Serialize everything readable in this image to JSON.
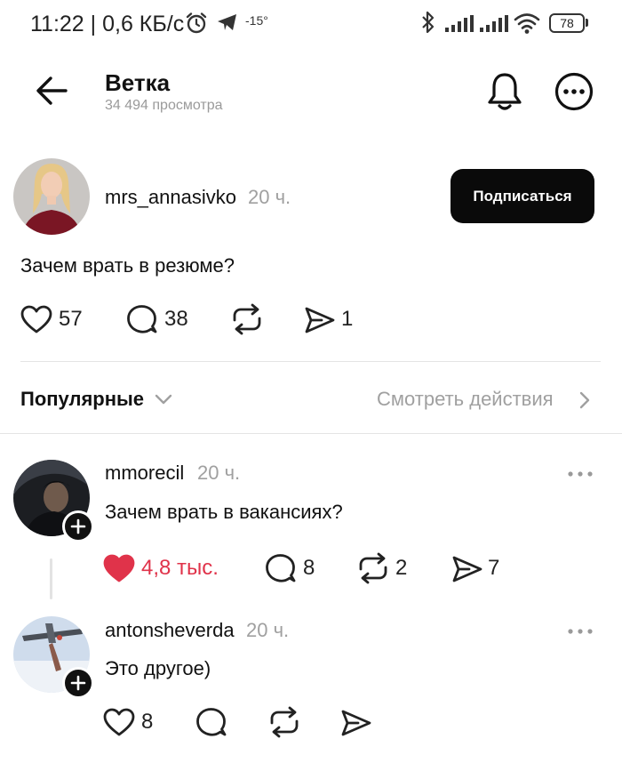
{
  "status_bar": {
    "time_speed": "11:22 | 0,6 КБ/с",
    "temperature": "-15°",
    "battery": "78"
  },
  "header": {
    "title": "Ветка",
    "views": "34 494 просмотра"
  },
  "post": {
    "author": "mrs_annasivko",
    "time": "20 ч.",
    "follow_label": "Подписаться",
    "text": "Зачем врать в резюме?",
    "likes": "57",
    "comments": "38",
    "shares": "1"
  },
  "filter": {
    "sort_label": "Популярные",
    "activity_link": "Смотреть действия"
  },
  "replies": [
    {
      "author": "mmorecil",
      "time": "20 ч.",
      "text": "Зачем врать в вакансиях?",
      "likes": "4,8 тыс.",
      "comments": "8",
      "reposts": "2",
      "shares": "7",
      "liked": true
    },
    {
      "author": "antonsheverda",
      "time": "20 ч.",
      "text": "Это другое)",
      "likes": "8"
    }
  ],
  "colors": {
    "liked": "#e0334a",
    "button_bg": "#0a0a0a",
    "muted_text": "#a0a0a0"
  },
  "icons": [
    "back-arrow-icon",
    "bell-icon",
    "more-icon",
    "heart-icon",
    "comment-icon",
    "repost-icon",
    "share-icon",
    "plus-icon",
    "chevron-down-icon",
    "chevron-right-icon"
  ]
}
